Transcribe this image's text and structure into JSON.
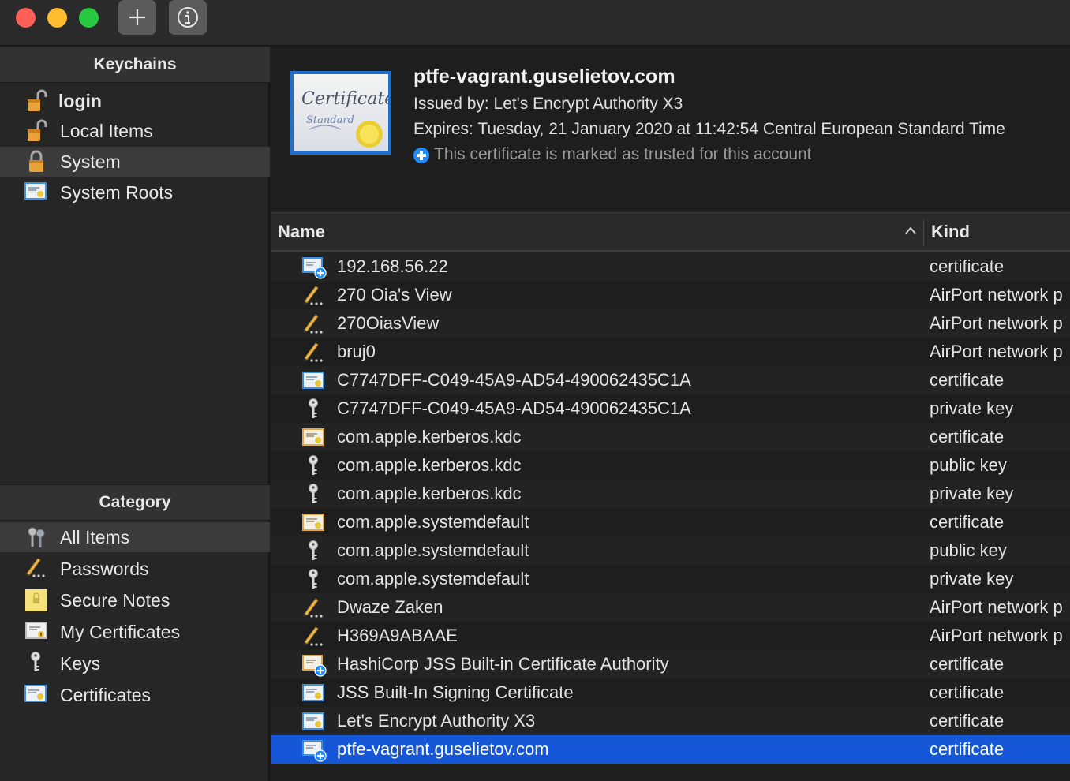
{
  "toolbar": {
    "add_icon": "plus-icon",
    "info_icon": "info-icon"
  },
  "sidebar": {
    "keychains_header": "Keychains",
    "keychains": [
      {
        "label": "login",
        "icon": "padlock-open-icon"
      },
      {
        "label": "Local Items",
        "icon": "padlock-open-icon"
      },
      {
        "label": "System",
        "icon": "padlock-locked-icon",
        "selected": true
      },
      {
        "label": "System Roots",
        "icon": "certificate-icon"
      }
    ],
    "category_header": "Category",
    "categories": [
      {
        "label": "All Items",
        "icon": "keys-icon",
        "selected": true
      },
      {
        "label": "Passwords",
        "icon": "pencil-icon"
      },
      {
        "label": "Secure Notes",
        "icon": "secure-note-icon"
      },
      {
        "label": "My Certificates",
        "icon": "my-certificate-icon"
      },
      {
        "label": "Keys",
        "icon": "key-icon"
      },
      {
        "label": "Certificates",
        "icon": "certificate-icon"
      }
    ]
  },
  "detail": {
    "title": "ptfe-vagrant.guselietov.com",
    "issued_by": "Issued by: Let's Encrypt Authority X3",
    "expires": "Expires: Tuesday, 21 January 2020 at 11:42:54 Central European Standard Time",
    "trust": "This certificate is marked as trusted for this account",
    "cert_script": "Certificate",
    "cert_sub": "Standard"
  },
  "table": {
    "columns": {
      "name": "Name",
      "kind": "Kind"
    },
    "rows": [
      {
        "name": "192.168.56.22",
        "kind": "certificate",
        "icon": "trusted-certificate-icon"
      },
      {
        "name": "270 Oia's View",
        "kind": "AirPort network p",
        "icon": "pencil-icon"
      },
      {
        "name": "270OiasView",
        "kind": "AirPort network p",
        "icon": "pencil-icon"
      },
      {
        "name": "bruj0",
        "kind": "AirPort network p",
        "icon": "pencil-icon"
      },
      {
        "name": "C7747DFF-C049-45A9-AD54-490062435C1A",
        "kind": "certificate",
        "icon": "certificate-icon"
      },
      {
        "name": "C7747DFF-C049-45A9-AD54-490062435C1A",
        "kind": "private key",
        "icon": "key-icon"
      },
      {
        "name": "com.apple.kerberos.kdc",
        "kind": "certificate",
        "icon": "root-certificate-icon"
      },
      {
        "name": "com.apple.kerberos.kdc",
        "kind": "public key",
        "icon": "key-icon"
      },
      {
        "name": "com.apple.kerberos.kdc",
        "kind": "private key",
        "icon": "key-icon"
      },
      {
        "name": "com.apple.systemdefault",
        "kind": "certificate",
        "icon": "root-certificate-icon"
      },
      {
        "name": "com.apple.systemdefault",
        "kind": "public key",
        "icon": "key-icon"
      },
      {
        "name": "com.apple.systemdefault",
        "kind": "private key",
        "icon": "key-icon"
      },
      {
        "name": "Dwaze Zaken",
        "kind": "AirPort network p",
        "icon": "pencil-icon"
      },
      {
        "name": "H369A9ABAAE",
        "kind": "AirPort network p",
        "icon": "pencil-icon"
      },
      {
        "name": "HashiCorp JSS Built-in Certificate Authority",
        "kind": "certificate",
        "icon": "trusted-root-certificate-icon"
      },
      {
        "name": "JSS Built-In Signing Certificate",
        "kind": "certificate",
        "icon": "certificate-icon"
      },
      {
        "name": "Let's Encrypt Authority X3",
        "kind": "certificate",
        "icon": "certificate-icon"
      },
      {
        "name": "ptfe-vagrant.guselietov.com",
        "kind": "certificate",
        "icon": "trusted-certificate-icon",
        "selected": true
      }
    ]
  },
  "colors": {
    "selection": "#1557d6",
    "trust_accent": "#1e8cff",
    "lock_gold": "#e8a33a"
  }
}
